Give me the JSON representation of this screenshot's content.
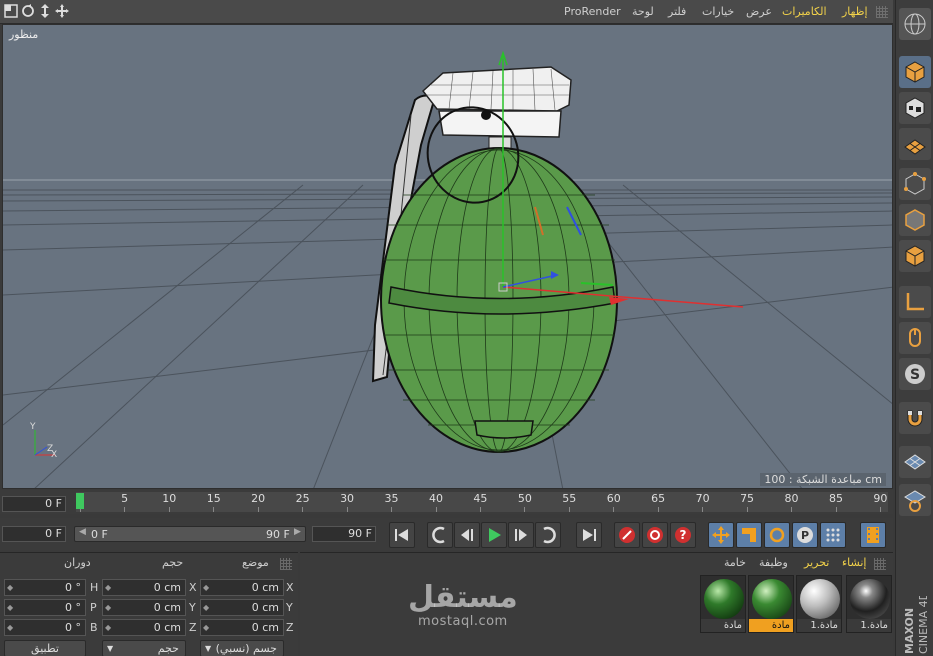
{
  "viewport_menu": {
    "items": [
      "إظهار",
      "الكاميرات",
      "عرض",
      "خيارات",
      "فلتر",
      "لوحة",
      "ProRender"
    ],
    "highlighted": [
      "إظهار",
      "الكاميرات"
    ],
    "nav_icons": [
      "maximize-icon",
      "rotate-icon",
      "move-vertical-icon",
      "move-cross-icon"
    ]
  },
  "viewport": {
    "label": "منظور",
    "grid_spacing": "مباعدة الشبكة : 100 cm",
    "background": "#687380",
    "object_color": "#5a9a4a"
  },
  "timeline": {
    "start_field": "0 F",
    "ticks": [
      "0",
      "5",
      "10",
      "15",
      "20",
      "25",
      "30",
      "35",
      "40",
      "45",
      "50",
      "55",
      "60",
      "65",
      "70",
      "75",
      "80",
      "85",
      "90"
    ],
    "current_frame": 0
  },
  "transport": {
    "current_field": "0 F",
    "range_start": "0 F",
    "range_end": "90 F",
    "end_field": "90 F"
  },
  "coordinates": {
    "headers": {
      "position": "موضع",
      "size": "حجم",
      "rotation": "دوران"
    },
    "rows": [
      {
        "axis": "X",
        "pos": "0 cm",
        "size_axis": "X",
        "size": "0 cm",
        "rot_axis": "H",
        "rot": "0 °"
      },
      {
        "axis": "Y",
        "pos": "0 cm",
        "size_axis": "Y",
        "size": "0 cm",
        "rot_axis": "P",
        "rot": "0 °"
      },
      {
        "axis": "Z",
        "pos": "0 cm",
        "size_axis": "Z",
        "size": "0 cm",
        "rot_axis": "B",
        "rot": "0 °"
      }
    ],
    "mode_dropdown": "جسم (نسبي)",
    "size_dropdown": "حجم",
    "apply_button": "تطبيق"
  },
  "materials": {
    "menu": [
      "إنشاء",
      "تحرير",
      "وظيفة",
      "خامة"
    ],
    "highlighted_menu": [
      "إنشاء",
      "تحرير"
    ],
    "items": [
      {
        "label": "مادة",
        "selected": false,
        "color": "#2f7a2a"
      },
      {
        "label": "مادة",
        "selected": true,
        "color": "#3a8a32"
      },
      {
        "label": "مادة.1",
        "selected": false,
        "color": "#bdbdbd"
      },
      {
        "label": "مادة.1",
        "selected": false,
        "color": "#202020"
      }
    ]
  },
  "watermark": {
    "arabic": "مستقل",
    "latin": "mostaql.com"
  },
  "branding": {
    "maxon": "MAXON",
    "product": "CINEMA 4D"
  },
  "colors": {
    "accent_yellow": "#f2d24a",
    "accent_orange": "#f0a020",
    "playhead_green": "#3fc85f",
    "tool_blue": "#5d7fa8"
  }
}
